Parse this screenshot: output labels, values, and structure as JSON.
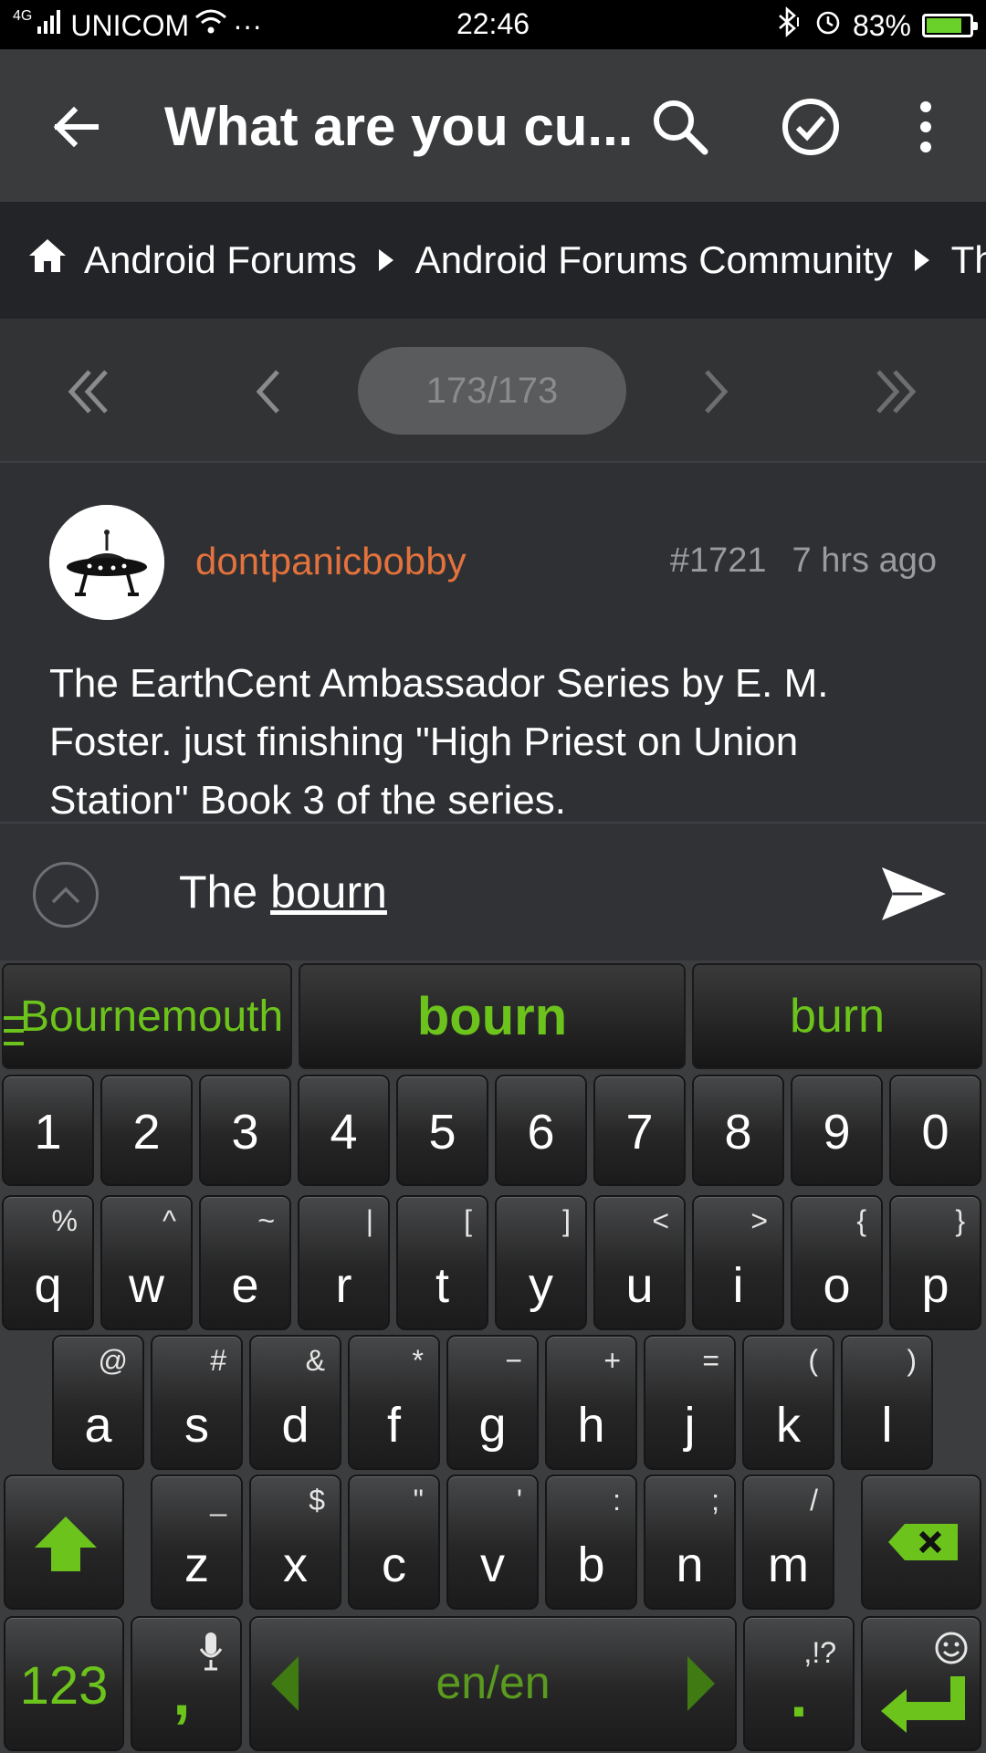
{
  "status_bar": {
    "network": "4G",
    "carrier": "UNICOM",
    "more": "···",
    "time": "22:46",
    "battery": "83%",
    "battery_level": 0.83
  },
  "app_bar": {
    "title": "What are you cu...",
    "icons": [
      "back-arrow-icon",
      "search-icon",
      "check-circle-icon",
      "more-vert-icon"
    ]
  },
  "breadcrumb": {
    "items": [
      "Android Forums",
      "Android Forums Community",
      "The"
    ]
  },
  "pager": {
    "page_indicator": "173/173"
  },
  "post": {
    "username": "dontpanicbobby",
    "number": "#1721",
    "time_ago": "7 hrs ago",
    "body": "The EarthCent Ambassador Series by E. M. Foster. just finishing \"High Priest on Union Station\" Book 3 of the series."
  },
  "reply": {
    "text_prefix": "The ",
    "composing": "bourn"
  },
  "keyboard": {
    "suggestions": [
      "Bournemouth",
      "bourn",
      "burn"
    ],
    "number_row": [
      "1",
      "2",
      "3",
      "4",
      "5",
      "6",
      "7",
      "8",
      "9",
      "0"
    ],
    "row1": [
      {
        "main": "q",
        "alt": "%"
      },
      {
        "main": "w",
        "alt": "^"
      },
      {
        "main": "e",
        "alt": "~"
      },
      {
        "main": "r",
        "alt": "|"
      },
      {
        "main": "t",
        "alt": "["
      },
      {
        "main": "y",
        "alt": "]"
      },
      {
        "main": "u",
        "alt": "<"
      },
      {
        "main": "i",
        "alt": ">"
      },
      {
        "main": "o",
        "alt": "{"
      },
      {
        "main": "p",
        "alt": "}"
      }
    ],
    "row2": [
      {
        "main": "a",
        "alt": "@"
      },
      {
        "main": "s",
        "alt": "#"
      },
      {
        "main": "d",
        "alt": "&"
      },
      {
        "main": "f",
        "alt": "*"
      },
      {
        "main": "g",
        "alt": "−"
      },
      {
        "main": "h",
        "alt": "+"
      },
      {
        "main": "j",
        "alt": "="
      },
      {
        "main": "k",
        "alt": "("
      },
      {
        "main": "l",
        "alt": ")"
      }
    ],
    "row3": [
      {
        "main": "z",
        "alt": "_"
      },
      {
        "main": "x",
        "alt": "$"
      },
      {
        "main": "c",
        "alt": "\""
      },
      {
        "main": "v",
        "alt": "'"
      },
      {
        "main": "b",
        "alt": ":"
      },
      {
        "main": "n",
        "alt": ";"
      },
      {
        "main": "m",
        "alt": "/"
      }
    ],
    "key_123": "123",
    "comma": ",",
    "language": "en/en",
    "period": ".",
    "period_alt": ",!?",
    "accent_color": "#6cc31c"
  }
}
